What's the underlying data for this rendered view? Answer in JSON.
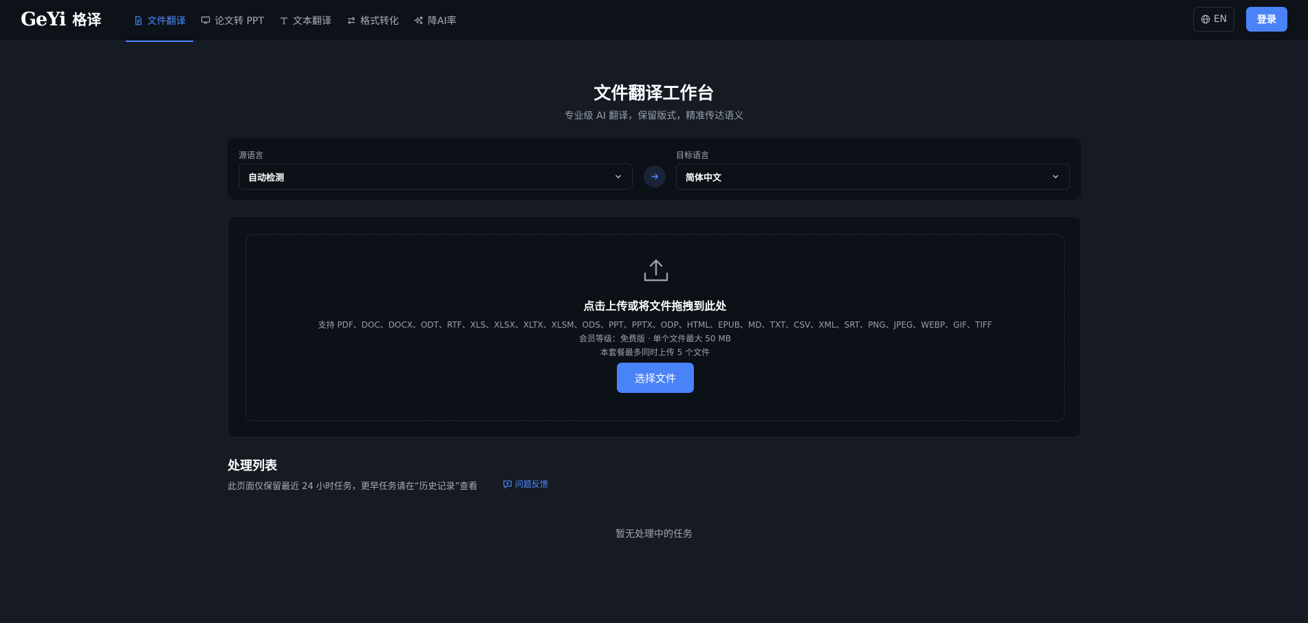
{
  "brand": {
    "name_en": "GeYi",
    "name_cn": "格译"
  },
  "nav": {
    "items": [
      {
        "label": "文件翻译",
        "icon": "document-icon",
        "active": true
      },
      {
        "label": "论文转 PPT",
        "icon": "presentation-icon",
        "active": false
      },
      {
        "label": "文本翻译",
        "icon": "text-icon",
        "active": false
      },
      {
        "label": "格式转化",
        "icon": "swap-arrows-icon",
        "active": false
      },
      {
        "label": "降AI率",
        "icon": "sparkles-icon",
        "active": false
      }
    ],
    "language_label": "EN",
    "login_label": "登录"
  },
  "page": {
    "title": "文件翻译工作台",
    "subtitle": "专业级 AI 翻译，保留版式，精准传达语义"
  },
  "languages": {
    "source_label": "源语言",
    "source_value": "自动检测",
    "target_label": "目标语言",
    "target_value": "简体中文"
  },
  "upload": {
    "title": "点击上传或将文件拖拽到此处",
    "formats": "支持 PDF、DOC、DOCX、ODT、RTF、XLS、XLSX、XLTX、XLSM、ODS、PPT、PPTX、ODP、HTML、EPUB、MD、TXT、CSV、XML、SRT、PNG、JPEG、WEBP、GIF、TIFF",
    "membership": "会员等级：免费版 · 单个文件最大 50 MB",
    "limit": "本套餐最多同时上传 5 个文件",
    "button_label": "选择文件"
  },
  "tasks": {
    "title": "处理列表",
    "note": "此页面仅保留最近 24 小时任务，更早任务请在“历史记录”查看",
    "feedback_label": "问题反馈",
    "empty_text": "暂无处理中的任务"
  },
  "colors": {
    "background": "#151a23",
    "accent": "#4a83f7",
    "active_nav": "#4d8dff"
  }
}
